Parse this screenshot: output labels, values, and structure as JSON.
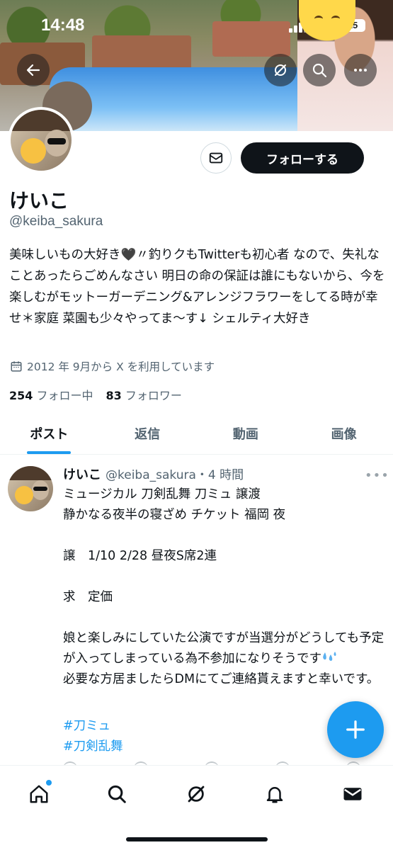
{
  "status_bar": {
    "time": "14:48",
    "battery": "15"
  },
  "header": {
    "back_icon": "arrow-left-icon",
    "grok_icon": "grok-icon",
    "search_icon": "search-icon",
    "more_icon": "more-horizontal-icon"
  },
  "profile": {
    "name": "けいこ",
    "handle": "@keiba_sakura",
    "bio": "美味しいもの大好き🖤〃釣りクもTwitterも初心者 なので、失礼なことあったらごめんなさい 明日の命の保証は誰にもないから、今を楽しむがモットーガーデニング&アレンジフラワーをしてる時が幸せ＊家庭 菜園も少々やってま〜す↓ シェルティ大好き",
    "joined": "2012 年 9月から X を利用しています",
    "following_count": "254",
    "following_label": "フォロー中",
    "followers_count": "83",
    "followers_label": "フォロワー",
    "follow_button": "フォローする"
  },
  "tabs": [
    {
      "label": "ポスト",
      "active": true
    },
    {
      "label": "返信",
      "active": false
    },
    {
      "label": "動画",
      "active": false
    },
    {
      "label": "画像",
      "active": false
    }
  ],
  "post": {
    "name": "けいこ",
    "meta": "@keiba_sakura・4 時間",
    "lines_1": "ミュージカル 刀剣乱舞 刀ミュ 譲渡\n静かなる夜半の寝ざめ チケット 福岡 夜\n\n譲　1/10 2/28 昼夜S席2連\n\n求　定価\n\n娘と楽しみにしていた公演ですが当選分がどうしても予定が入ってしまっている為不参加になりそうです",
    "lines_2": "必要な方居ましたらDMにてご連絡貰えますと幸いです。",
    "hashtags": [
      "#刀ミュ",
      "#刀剣乱舞"
    ]
  },
  "bottom_nav": [
    "home-icon",
    "search-icon",
    "grok-icon",
    "notifications-icon",
    "messages-icon"
  ],
  "colors": {
    "accent": "#1d9bf0",
    "text": "#0f1419",
    "secondary": "#536471"
  }
}
